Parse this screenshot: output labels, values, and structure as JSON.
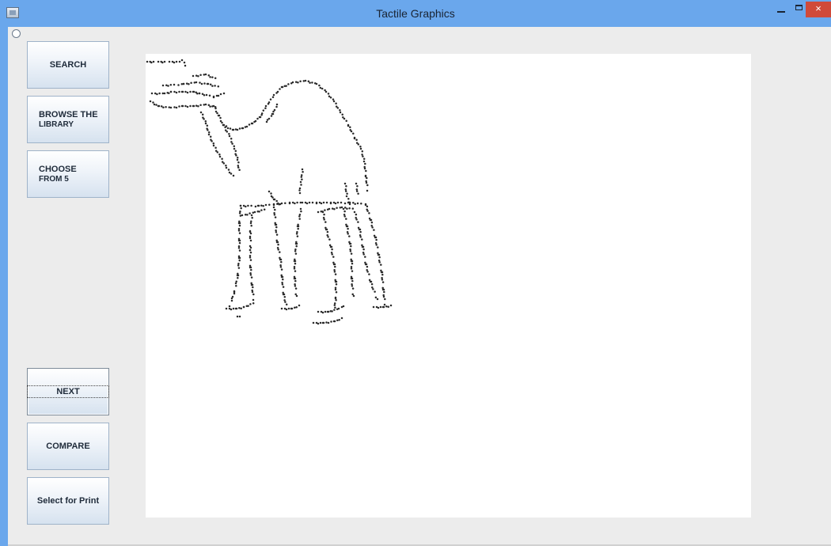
{
  "window": {
    "title": "Tactile Graphics",
    "close_glyph": "×"
  },
  "sidebar": {
    "search_label": "SEARCH",
    "browse_label_1": "BROWSE THE",
    "browse_label_2": "LIBRARY",
    "choose_label_1": "CHOOSE",
    "choose_label_2": "FROM 5",
    "next_label": "NEXT",
    "compare_label": "COMPARE",
    "print_label": "Select for Print"
  },
  "graphic": {
    "subject": "camel",
    "style": "braille-dot tactile image",
    "dot_color": "#2a2a2a"
  }
}
